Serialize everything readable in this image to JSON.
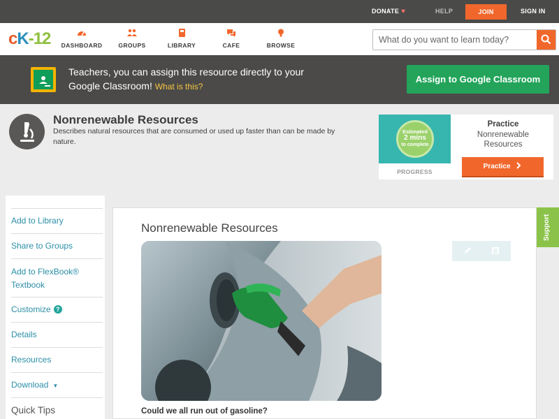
{
  "topbar": {
    "donate": "DONATE",
    "help": "HELP",
    "join": "JOIN",
    "signin": "SIGN IN"
  },
  "logo": {
    "c": "c",
    "k": "K",
    "n": "-12"
  },
  "nav": {
    "items": [
      {
        "label": "DASHBOARD",
        "icon": "dashboard-icon"
      },
      {
        "label": "GROUPS",
        "icon": "groups-icon"
      },
      {
        "label": "LIBRARY",
        "icon": "library-icon"
      },
      {
        "label": "CAFE",
        "icon": "cafe-icon"
      },
      {
        "label": "BROWSE",
        "icon": "browse-icon"
      }
    ]
  },
  "search": {
    "placeholder": "What do you want to learn today?",
    "value": ""
  },
  "classroom": {
    "text": "Teachers, you can assign this resource directly to your Google Classroom!",
    "link": "What is this?",
    "button": "Assign to Google Classroom"
  },
  "header": {
    "title": "Nonrenewable Resources",
    "description": "Describes natural resources that are consumed or used up faster than can be made by nature."
  },
  "practice": {
    "estimate_line1": "Estimated",
    "estimate_line2": "2 mins",
    "estimate_line3": "to complete",
    "progress": "PROGRESS",
    "title": "Practice",
    "subtitle": "Nonrenewable Resources",
    "button": "Practice"
  },
  "sidebar": {
    "items": [
      {
        "label": "Add to Library"
      },
      {
        "label": "Share to Groups"
      },
      {
        "label": "Add to FlexBook® Textbook"
      },
      {
        "label": "Customize"
      },
      {
        "label": "Details"
      },
      {
        "label": "Resources"
      },
      {
        "label": "Download"
      }
    ],
    "quick_tips": "Quick Tips"
  },
  "content": {
    "title": "Nonrenewable Resources",
    "question": "Could we all run out of gasoline?"
  },
  "support": "Support",
  "colors": {
    "accent_orange": "#f1672b",
    "classroom_green": "#23a45a",
    "link_teal": "#2b8ea7",
    "support_green": "#8bc34a"
  }
}
